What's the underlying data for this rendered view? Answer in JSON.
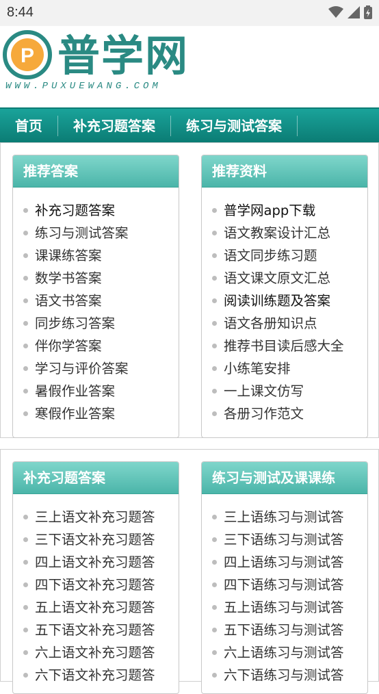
{
  "status": {
    "time": "8:44"
  },
  "logo": {
    "text": "普学网",
    "url": "WWW.PUXUEWANG.COM",
    "mark_letter": "P"
  },
  "nav": [
    "首页",
    "补充习题答案",
    "练习与测试答案"
  ],
  "section1": {
    "left": {
      "title": "推荐答案",
      "items": [
        "补充习题答案",
        "练习与测试答案",
        "课课练答案",
        "数学书答案",
        "语文书答案",
        "同步练习答案",
        "伴你学答案",
        "学习与评价答案",
        "暑假作业答案",
        "寒假作业答案"
      ]
    },
    "right": {
      "title": "推荐资料",
      "items": [
        "普学网app下载",
        "语文教案设计汇总",
        "语文同步练习题",
        "语文课文原文汇总",
        "阅读训练题及答案",
        "语文各册知识点",
        "推荐书目读后感大全",
        "小练笔安排",
        "一上课文仿写",
        "各册习作范文"
      ]
    }
  },
  "section2": {
    "left": {
      "title": "补充习题答案",
      "items": [
        "三上语文补充习题答",
        "三下语文补充习题答",
        "四上语文补充习题答",
        "四下语文补充习题答",
        "五上语文补充习题答",
        "五下语文补充习题答",
        "六上语文补充习题答",
        "六下语文补充习题答"
      ]
    },
    "right": {
      "title": "练习与测试及课课练",
      "items": [
        "三上语练习与测试答",
        "三下语练习与测试答",
        "四上语练习与测试答",
        "四下语练习与测试答",
        "五上语练习与测试答",
        "五下语练习与测试答",
        "六上语练习与测试答",
        "六下语练习与测试答"
      ]
    }
  },
  "colors": {
    "brand": "#2a8a83",
    "nav": "#0b7c74",
    "box_head": "#4bb5a9"
  }
}
